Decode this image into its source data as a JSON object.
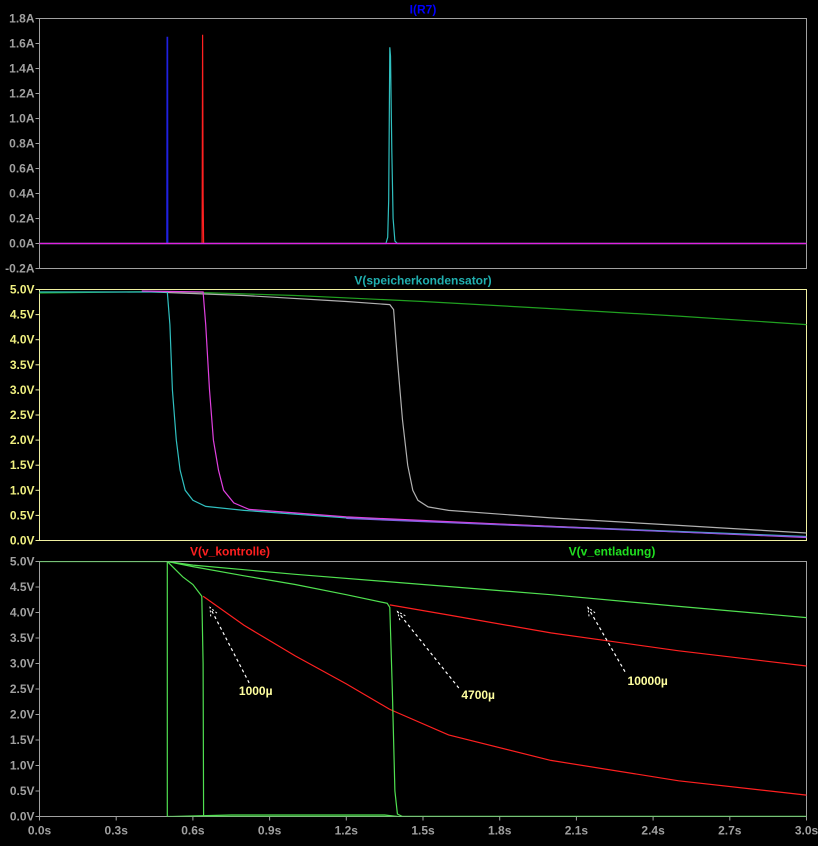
{
  "chart_data": [
    {
      "type": "line",
      "title": "I(R7)",
      "title_color": "#0000ff",
      "ylim": [
        -0.2,
        1.8
      ],
      "yticks": [
        "-0.2A",
        "0.0A",
        "0.2A",
        "0.4A",
        "0.6A",
        "0.8A",
        "1.0A",
        "1.2A",
        "1.4A",
        "1.6A",
        "1.8A"
      ],
      "tick_color": "#a0a0a0",
      "frame_color": "#a0a0a0",
      "series": [
        {
          "name": "blue",
          "color": "#2020e0",
          "points": [
            [
              0,
              0
            ],
            [
              0.498,
              0
            ],
            [
              0.499,
              1.65
            ],
            [
              0.501,
              1.65
            ],
            [
              0.502,
              0
            ],
            [
              3,
              0
            ]
          ]
        },
        {
          "name": "red",
          "color": "#ff2020",
          "points": [
            [
              0,
              0
            ],
            [
              0.636,
              0
            ],
            [
              0.638,
              1.67
            ],
            [
              0.64,
              0.38
            ],
            [
              0.642,
              0
            ],
            [
              3,
              0
            ]
          ]
        },
        {
          "name": "cyan",
          "color": "#30c0c0",
          "points": [
            [
              0,
              0
            ],
            [
              1.355,
              0
            ],
            [
              1.362,
              0.05
            ],
            [
              1.366,
              0.35
            ],
            [
              1.37,
              1.57
            ],
            [
              1.373,
              1.5
            ],
            [
              1.378,
              0.75
            ],
            [
              1.383,
              0.2
            ],
            [
              1.39,
              0.02
            ],
            [
              1.4,
              0
            ],
            [
              3,
              0
            ]
          ]
        },
        {
          "name": "magenta",
          "color": "#e020e0",
          "points": [
            [
              0,
              0
            ],
            [
              3,
              0
            ]
          ]
        }
      ]
    },
    {
      "type": "line",
      "title": "V(speicherkondensator)",
      "title_color": "#20b0b0",
      "ylim": [
        0,
        5
      ],
      "yticks": [
        "0.0V",
        "0.5V",
        "1.0V",
        "1.5V",
        "2.0V",
        "2.5V",
        "3.0V",
        "3.5V",
        "4.0V",
        "4.5V",
        "5.0V"
      ],
      "tick_color": "#f0f080",
      "frame_color": "#f0f0a0",
      "series": [
        {
          "name": "green",
          "color": "#20a020",
          "points": [
            [
              0,
              4.93
            ],
            [
              0.5,
              4.96
            ],
            [
              1.0,
              4.88
            ],
            [
              1.5,
              4.76
            ],
            [
              2.0,
              4.62
            ],
            [
              2.5,
              4.47
            ],
            [
              3.0,
              4.3
            ]
          ]
        },
        {
          "name": "grey",
          "color": "#b0b0b0",
          "points": [
            [
              0.4,
              4.96
            ],
            [
              0.8,
              4.88
            ],
            [
              1.2,
              4.76
            ],
            [
              1.37,
              4.7
            ],
            [
              1.385,
              4.6
            ],
            [
              1.4,
              3.6
            ],
            [
              1.42,
              2.4
            ],
            [
              1.44,
              1.5
            ],
            [
              1.46,
              1.0
            ],
            [
              1.48,
              0.8
            ],
            [
              1.52,
              0.67
            ],
            [
              1.6,
              0.6
            ],
            [
              2.0,
              0.45
            ],
            [
              2.5,
              0.3
            ],
            [
              3.0,
              0.15
            ]
          ]
        },
        {
          "name": "cyan",
          "color": "#30c0c0",
          "points": [
            [
              0,
              4.95
            ],
            [
              0.5,
              4.95
            ],
            [
              0.51,
              4.3
            ],
            [
              0.52,
              3.0
            ],
            [
              0.535,
              2.0
            ],
            [
              0.55,
              1.4
            ],
            [
              0.57,
              1.0
            ],
            [
              0.6,
              0.8
            ],
            [
              0.65,
              0.68
            ],
            [
              0.8,
              0.6
            ],
            [
              1.2,
              0.45
            ],
            [
              2.0,
              0.28
            ],
            [
              3.0,
              0.08
            ]
          ]
        },
        {
          "name": "magenta",
          "color": "#e040e0",
          "points": [
            [
              0.4,
              4.97
            ],
            [
              0.64,
              4.95
            ],
            [
              0.65,
              4.3
            ],
            [
              0.665,
              3.0
            ],
            [
              0.68,
              2.0
            ],
            [
              0.7,
              1.4
            ],
            [
              0.72,
              1.0
            ],
            [
              0.76,
              0.75
            ],
            [
              0.82,
              0.62
            ],
            [
              1.2,
              0.47
            ],
            [
              2.0,
              0.28
            ],
            [
              3.0,
              0.06
            ]
          ]
        },
        {
          "name": "violet",
          "color": "#8060e0",
          "points": [
            [
              1.2,
              0.44
            ],
            [
              2.0,
              0.27
            ],
            [
              3.0,
              0.07
            ]
          ]
        }
      ]
    },
    {
      "type": "line",
      "titles": [
        {
          "text": "V(v_kontrolle)",
          "color": "#ff2020",
          "position": "top-left"
        },
        {
          "text": "V(v_entladung)",
          "color": "#20e020",
          "position": "top-right"
        }
      ],
      "ylim": [
        0,
        5
      ],
      "yticks": [
        "0.0V",
        "0.5V",
        "1.0V",
        "1.5V",
        "2.0V",
        "2.5V",
        "3.0V",
        "3.5V",
        "4.0V",
        "4.5V",
        "5.0V"
      ],
      "tick_color": "#a0a0a0",
      "frame_color": "#a0a0a0",
      "series": [
        {
          "name": "red-1000u",
          "color": "#ff2020",
          "points": [
            [
              0.64,
              4.32
            ],
            [
              0.8,
              3.75
            ],
            [
              1.0,
              3.15
            ],
            [
              1.2,
              2.6
            ],
            [
              1.37,
              2.1
            ],
            [
              1.6,
              1.6
            ],
            [
              2.0,
              1.1
            ],
            [
              2.5,
              0.7
            ],
            [
              3.0,
              0.42
            ]
          ]
        },
        {
          "name": "red-4700u",
          "color": "#ff2020",
          "points": [
            [
              1.37,
              4.15
            ],
            [
              1.6,
              3.95
            ],
            [
              2.0,
              3.6
            ],
            [
              2.5,
              3.25
            ],
            [
              3.0,
              2.95
            ]
          ]
        },
        {
          "name": "green-10000u",
          "color": "#50e050",
          "points": [
            [
              0,
              5.0
            ],
            [
              0.5,
              5.0
            ],
            [
              0.6,
              4.93
            ],
            [
              1.0,
              4.75
            ],
            [
              1.5,
              4.55
            ],
            [
              2.0,
              4.35
            ],
            [
              2.5,
              4.12
            ],
            [
              3.0,
              3.9
            ]
          ]
        },
        {
          "name": "green-4700u",
          "color": "#50e050",
          "points": [
            [
              0.5,
              5.0
            ],
            [
              0.6,
              4.9
            ],
            [
              0.8,
              4.72
            ],
            [
              1.0,
              4.55
            ],
            [
              1.2,
              4.35
            ],
            [
              1.36,
              4.18
            ],
            [
              1.37,
              4.1
            ],
            [
              1.38,
              2.5
            ],
            [
              1.39,
              0.5
            ],
            [
              1.4,
              0.05
            ],
            [
              1.42,
              0
            ],
            [
              3.0,
              0
            ]
          ]
        },
        {
          "name": "green-1000u",
          "color": "#50e050",
          "points": [
            [
              0.5,
              5.0
            ],
            [
              0.52,
              4.9
            ],
            [
              0.56,
              4.7
            ],
            [
              0.6,
              4.55
            ],
            [
              0.635,
              4.32
            ],
            [
              0.64,
              3.0
            ],
            [
              0.642,
              0
            ],
            [
              3.0,
              0
            ]
          ]
        },
        {
          "name": "green-step",
          "color": "#50e050",
          "points": [
            [
              0.5,
              5.0
            ],
            [
              0.5,
              0
            ],
            [
              0.52,
              0
            ],
            [
              0.75,
              0.03
            ],
            [
              1.35,
              0.03
            ],
            [
              1.4,
              0
            ]
          ]
        }
      ],
      "annotations": [
        {
          "text": "1000µ",
          "tip": [
            0.667,
            4.1
          ],
          "tail": [
            0.82,
            2.62
          ],
          "label_at": [
            0.78,
            2.38
          ]
        },
        {
          "text": "4700µ",
          "tip": [
            1.4,
            4.02
          ],
          "tail": [
            1.64,
            2.52
          ],
          "label_at": [
            1.65,
            2.3
          ]
        },
        {
          "text": "10000µ",
          "tip": [
            2.145,
            4.1
          ],
          "tail": [
            2.29,
            2.84
          ],
          "label_at": [
            2.3,
            2.58
          ]
        }
      ]
    }
  ],
  "x_axis": {
    "xlim": [
      0,
      3.0
    ],
    "ticks": [
      "0.0s",
      "0.3s",
      "0.6s",
      "0.9s",
      "1.2s",
      "1.5s",
      "1.8s",
      "2.1s",
      "2.4s",
      "2.7s",
      "3.0s"
    ],
    "tick_values": [
      0,
      0.3,
      0.6,
      0.9,
      1.2,
      1.5,
      1.8,
      2.1,
      2.4,
      2.7,
      3.0
    ]
  }
}
